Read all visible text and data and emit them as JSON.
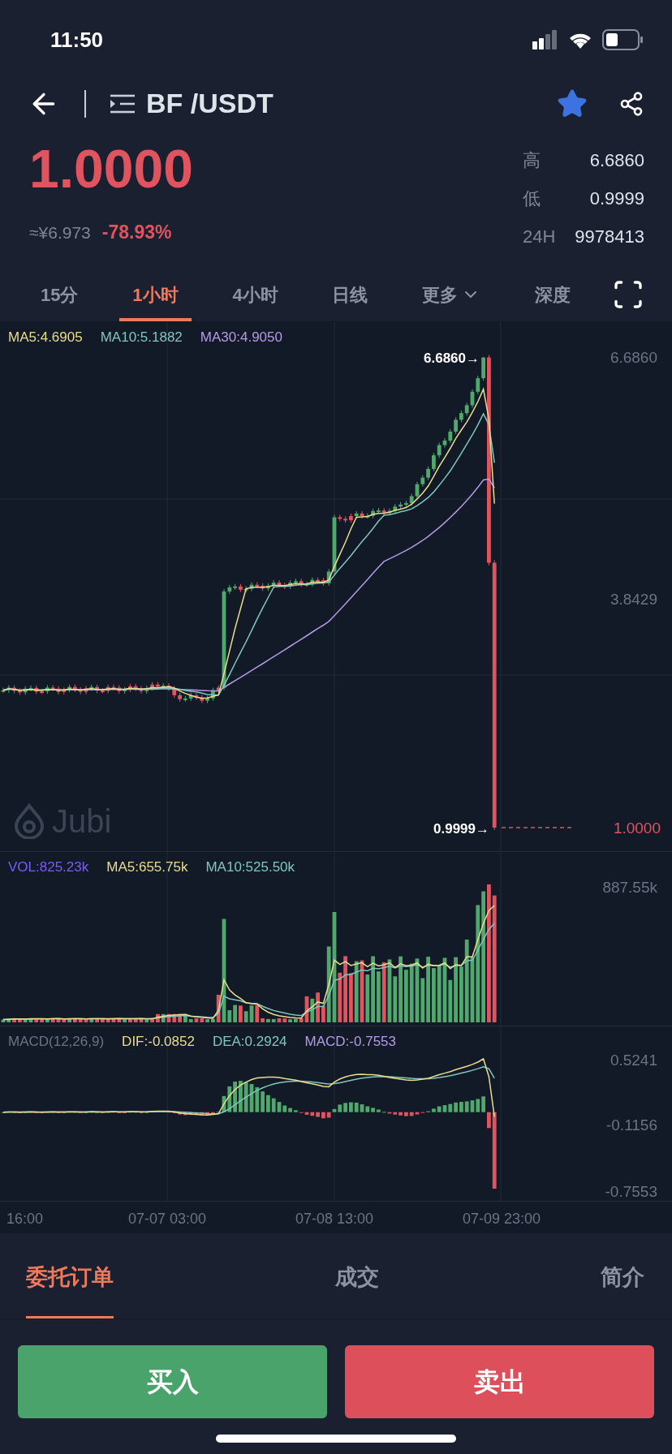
{
  "status_bar": {
    "time": "11:50"
  },
  "header": {
    "pair": "BF /USDT",
    "favorite": true
  },
  "ticker": {
    "price": "1.0000",
    "cny": "≈¥6.973",
    "change": "-78.93%",
    "stats": [
      {
        "label": "高",
        "value": "6.6860"
      },
      {
        "label": "低",
        "value": "0.9999"
      },
      {
        "label": "24H",
        "value": "9978413"
      }
    ]
  },
  "intervals": [
    {
      "label": "15分",
      "selected": false,
      "kind": "tab"
    },
    {
      "label": "1小时",
      "selected": true,
      "kind": "tab"
    },
    {
      "label": "4小时",
      "selected": false,
      "kind": "tab"
    },
    {
      "label": "日线",
      "selected": false,
      "kind": "tab"
    },
    {
      "label": "更多",
      "selected": false,
      "kind": "dropdown"
    },
    {
      "label": "深度",
      "selected": false,
      "kind": "tab"
    }
  ],
  "price_chart": {
    "legend": [
      {
        "text": "MA5:4.6905",
        "color": "#e8dc8e"
      },
      {
        "text": "MA10:5.1882",
        "color": "#7fc7bd"
      },
      {
        "text": "MA30:4.9050",
        "color": "#b49ae6"
      }
    ],
    "axis_labels": [
      "6.6860",
      "3.8429"
    ],
    "high_marker": "6.6860→",
    "low_marker": "0.9999→",
    "last_price": "1.0000",
    "logo": "Jubi"
  },
  "volume_chart": {
    "legend": [
      {
        "text": "VOL:825.23k",
        "color": "#7a5cf0"
      },
      {
        "text": "MA5:655.75k",
        "color": "#e8dc8e"
      },
      {
        "text": "MA10:525.50k",
        "color": "#7fc7bd"
      }
    ],
    "axis_labels": [
      "887.55k"
    ]
  },
  "macd_chart": {
    "legend": [
      {
        "text": "MACD(12,26,9)",
        "color": "#6b7385"
      },
      {
        "text": "DIF:-0.0852",
        "color": "#e8dc8e"
      },
      {
        "text": "DEA:0.2924",
        "color": "#7fc7bd"
      },
      {
        "text": "MACD:-0.7553",
        "color": "#b49ae6"
      }
    ],
    "axis_labels": [
      "0.5241",
      "-0.1156",
      "-0.7553"
    ]
  },
  "time_axis": [
    "16:00",
    "07-07 03:00",
    "07-08 13:00",
    "07-09 23:00"
  ],
  "bottom_tabs": [
    {
      "label": "委托订单",
      "selected": true
    },
    {
      "label": "成交",
      "selected": false
    },
    {
      "label": "简介",
      "selected": false
    }
  ],
  "actions": [
    {
      "label": "买入",
      "kind": "buy"
    },
    {
      "label": "卖出",
      "kind": "sell"
    }
  ]
}
